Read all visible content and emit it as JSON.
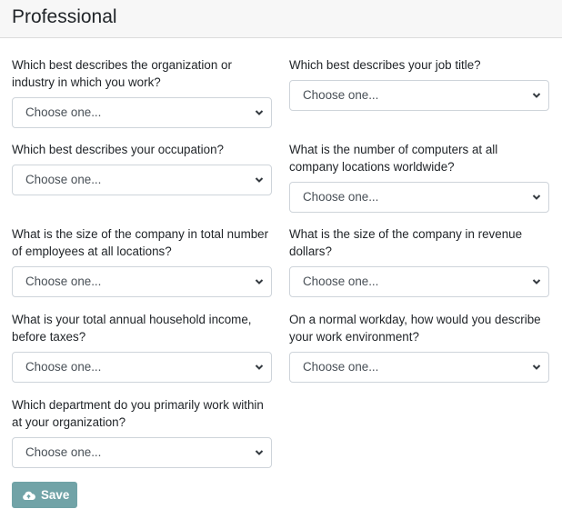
{
  "header": {
    "title": "Professional"
  },
  "fields": [
    {
      "label": "Which best describes the organization or industry in which you work?",
      "value": "Choose one..."
    },
    {
      "label": "Which best describes your job title?",
      "value": "Choose one..."
    },
    {
      "label": "Which best describes your occupation?",
      "value": "Choose one..."
    },
    {
      "label": "What is the number of computers at all company locations worldwide?",
      "value": "Choose one..."
    },
    {
      "label": "What is the size of the company in total number of employees at all locations?",
      "value": "Choose one..."
    },
    {
      "label": "What is the size of the company in revenue dollars?",
      "value": "Choose one..."
    },
    {
      "label": "What is your total annual household income, before taxes?",
      "value": "Choose one..."
    },
    {
      "label": "On a normal workday, how would you describe your work environment?",
      "value": "Choose one..."
    },
    {
      "label": "Which department do you primarily work within at your organization?",
      "value": "Choose one..."
    }
  ],
  "save": {
    "label": "Save",
    "icon": "cloud-upload-icon",
    "color": "#6a9fa3"
  }
}
